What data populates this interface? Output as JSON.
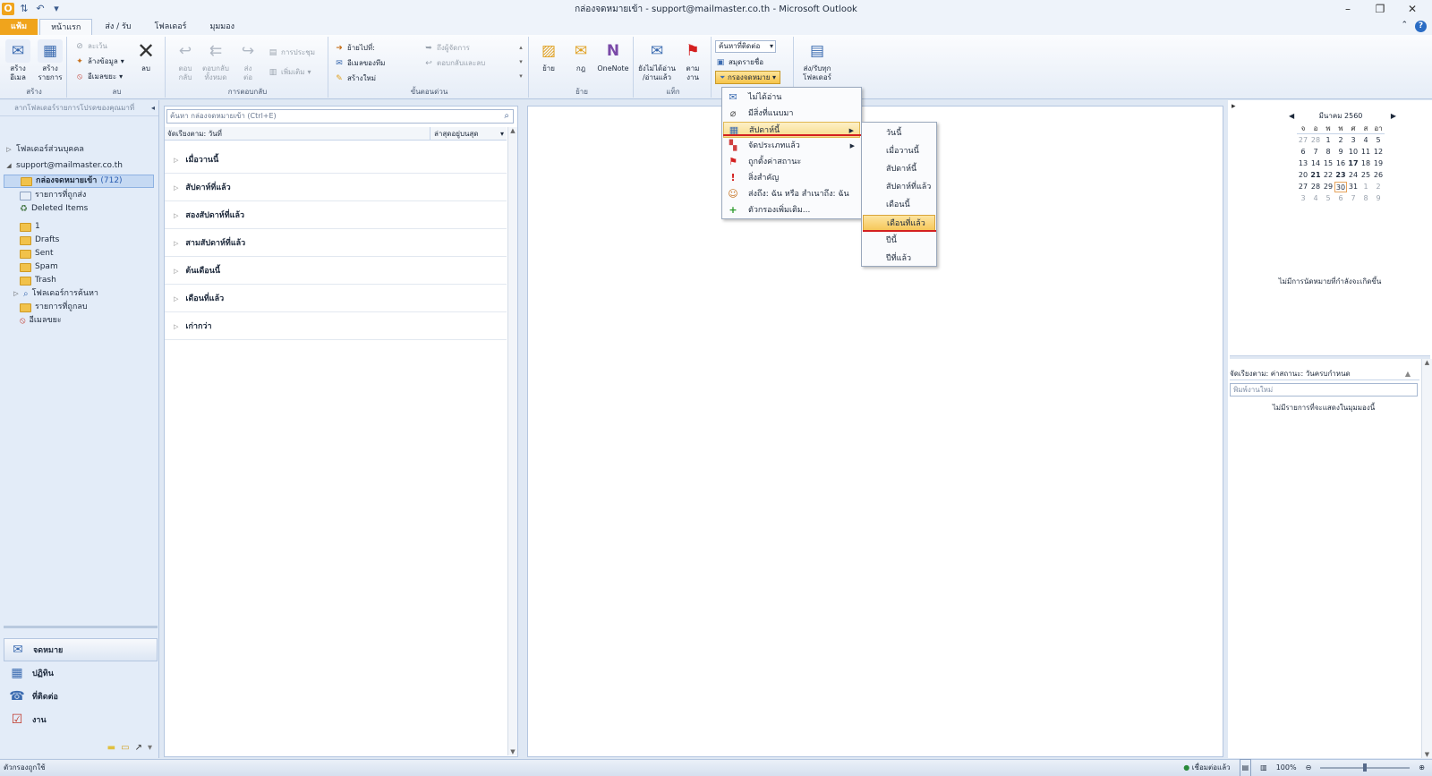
{
  "window": {
    "title": "กล่องจดหมายเข้า - support@mailmaster.co.th - Microsoft Outlook"
  },
  "tabs": [
    {
      "label": "แฟ้ม"
    },
    {
      "label": "หน้าแรก"
    },
    {
      "label": "ส่ง / รับ"
    },
    {
      "label": "โฟลเดอร์"
    },
    {
      "label": "มุมมอง"
    }
  ],
  "ribbon": {
    "new": {
      "new_email": "สร้าง\nอีเมล",
      "new_items": "สร้าง\nรายการ",
      "group": "สร้าง"
    },
    "delete": {
      "ignore": "ละเว้น",
      "cleanup": "ล้างข้อมูล",
      "junk": "อีเมลขยะ",
      "delete": "ลบ",
      "group": "ลบ"
    },
    "respond": {
      "reply": "ตอบ\nกลับ",
      "reply_all": "ตอบกลับ\nทั้งหมด",
      "forward": "ส่ง\nต่อ",
      "meeting": "การประชุม",
      "more": "เพิ่มเติม",
      "group": "การตอบกลับ"
    },
    "quick_steps": {
      "move_to": "ย้ายไปที่:",
      "to_manager": "ถึงผู้จัดการ",
      "team_email": "อีเมลของทีม",
      "reply_delete": "ตอบกลับและลบ",
      "create_new": "สร้างใหม่",
      "group": "ขั้นตอนด่วน"
    },
    "move": {
      "move": "ย้าย",
      "rules": "กฎ",
      "onenote": "OneNote",
      "group": "ย้าย"
    },
    "tags": {
      "unread_read": "ยังไม่ได้อ่าน\n/อ่านแล้ว",
      "follow_up": "ตาม\nงาน",
      "group": "แท็ก"
    },
    "find": {
      "find_contact": "ค้นหาที่ติดต่อ",
      "address_book": "สมุดรายชื่อ",
      "filter_email": "กรองจดหมาย"
    },
    "send_receive": {
      "send_receive_all": "ส่ง/รับทุก\nโฟลเดอร์"
    }
  },
  "nav": {
    "header": "ลากโฟลเดอร์รายการโปรดของคุณมาที่",
    "personal_folders": "โฟลเดอร์ส่วนบุคคล",
    "account": "support@mailmaster.co.th",
    "folders": [
      {
        "label": "กล่องจดหมายเข้า",
        "count": "(712)"
      },
      {
        "label": "รายการที่ถูกส่ง"
      },
      {
        "label": "Deleted Items"
      },
      {
        "label": "1"
      },
      {
        "label": "Drafts"
      },
      {
        "label": "Sent"
      },
      {
        "label": "Spam"
      },
      {
        "label": "Trash"
      },
      {
        "label": "โฟลเดอร์การค้นหา"
      },
      {
        "label": "รายการที่ถูกลบ"
      },
      {
        "label": "อีเมลขยะ"
      }
    ],
    "modules": [
      {
        "label": "จดหมาย"
      },
      {
        "label": "ปฏิทิน"
      },
      {
        "label": "ที่ติดต่อ"
      },
      {
        "label": "งาน"
      }
    ]
  },
  "list": {
    "search_placeholder": "ค้นหา กล่องจดหมายเข้า (Ctrl+E)",
    "sort_label": "จัดเรียงตาม: วันที่",
    "sort_order": "ล่าสุดอยู่บนสุด",
    "groups": [
      "เมื่อวานนี้",
      "สัปดาห์ที่แล้ว",
      "สองสัปดาห์ที่แล้ว",
      "สามสัปดาห์ที่แล้ว",
      "ต้นเดือนนี้",
      "เดือนที่แล้ว",
      "เก่ากว่า"
    ]
  },
  "filter_menu": {
    "items": [
      {
        "label": "ไม่ได้อ่าน"
      },
      {
        "label": "มีสิ่งที่แนบมา"
      },
      {
        "label": "สัปดาห์นี้"
      },
      {
        "label": "จัดประเภทแล้ว"
      },
      {
        "label": "ถูกตั้งค่าสถานะ"
      },
      {
        "label": "สิ่งสำคัญ"
      },
      {
        "label": "ส่งถึง: ฉัน หรือ สำเนาถึง: ฉัน"
      },
      {
        "label": "ตัวกรองเพิ่มเติม..."
      }
    ]
  },
  "date_submenu": {
    "items": [
      {
        "label": "วันนี้"
      },
      {
        "label": "เมื่อวานนี้"
      },
      {
        "label": "สัปดาห์นี้"
      },
      {
        "label": "สัปดาห์ที่แล้ว"
      },
      {
        "label": "เดือนนี้"
      },
      {
        "label": "เดือนที่แล้ว"
      },
      {
        "label": "ปีนี้"
      },
      {
        "label": "ปีที่แล้ว"
      }
    ]
  },
  "calendar": {
    "month": "มีนาคม 2560",
    "weekdays": [
      "จ",
      "อ",
      "พ",
      "พ",
      "ศ",
      "ส",
      "อา"
    ],
    "weeks": [
      [
        "27",
        "28",
        "1",
        "2",
        "3",
        "4",
        "5"
      ],
      [
        "6",
        "7",
        "8",
        "9",
        "10",
        "11",
        "12"
      ],
      [
        "13",
        "14",
        "15",
        "16",
        "17",
        "18",
        "19"
      ],
      [
        "20",
        "21",
        "22",
        "23",
        "24",
        "25",
        "26"
      ],
      [
        "27",
        "28",
        "29",
        "30",
        "31",
        "1",
        "2"
      ],
      [
        "3",
        "4",
        "5",
        "6",
        "7",
        "8",
        "9"
      ]
    ],
    "no_appointments": "ไม่มีการนัดหมายที่กำลังจะเกิดขึ้น"
  },
  "tasks": {
    "sort_label": "จัดเรียงตาม: ค่าสถานะ: วันครบกำหนด",
    "input_placeholder": "พิมพ์งานใหม่",
    "empty": "ไม่มีรายการที่จะแสดงในมุมมองนี้"
  },
  "status": {
    "left": "ตัวกรองถูกใช้",
    "connection": "เชื่อมต่อแล้ว",
    "zoom": "100%"
  },
  "colors": {
    "file_tab": "#f0a41c",
    "accent": "#2a6cc4",
    "highlight_red": "#d42020"
  }
}
